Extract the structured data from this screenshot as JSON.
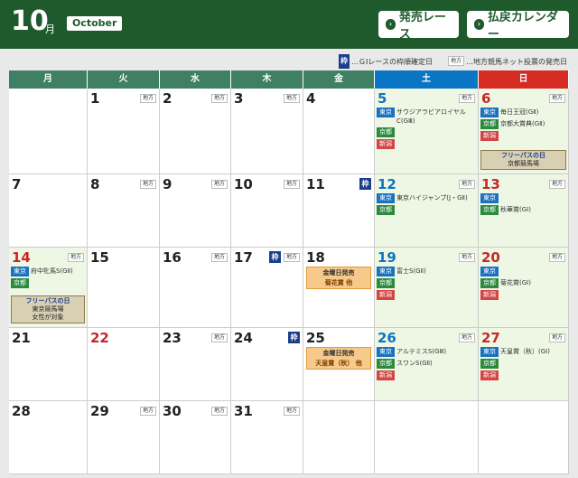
{
  "header": {
    "month": "10",
    "month_suffix": "月",
    "month_en": "October",
    "btn_race": "発売レース",
    "btn_payout": "払戻カレンダー",
    "btn_icon": "chevron-circle-icon"
  },
  "legend": {
    "waku_icon": "枠",
    "waku_text": "…ＧⅠレースの枠順確定日",
    "chiho_icon": "地方",
    "chiho_text": "…地方競馬ネット投票の発売日"
  },
  "weekdays": [
    "月",
    "火",
    "水",
    "木",
    "金",
    "土",
    "日"
  ],
  "weeks": [
    [
      {
        "day": "",
        "bg": "white"
      },
      {
        "day": "1",
        "chiho": "地方"
      },
      {
        "day": "2",
        "chiho": "地方"
      },
      {
        "day": "3",
        "chiho": "地方"
      },
      {
        "day": "4"
      },
      {
        "day": "5",
        "type": "sat",
        "bg": "green",
        "chiho": "地方",
        "events": [
          {
            "tag": "東京",
            "cls": "tokyo",
            "race": "サウジアラビアロイヤルC(GⅢ)"
          },
          {
            "tag": "京都",
            "cls": "kyoto",
            "race": ""
          },
          {
            "tag": "新潟",
            "cls": "niigata",
            "race": ""
          }
        ]
      },
      {
        "day": "6",
        "type": "sun",
        "bg": "green",
        "chiho": "地方",
        "events": [
          {
            "tag": "東京",
            "cls": "tokyo",
            "race": "毎日王冠(GⅡ)"
          },
          {
            "tag": "京都",
            "cls": "kyoto",
            "race": "京都大賞典(GⅡ)"
          },
          {
            "tag": "新潟",
            "cls": "niigata",
            "race": ""
          }
        ],
        "free": {
          "l1": "フリーパスの日",
          "l2": "京都競馬場",
          "l3": ""
        }
      }
    ],
    [
      {
        "day": "7"
      },
      {
        "day": "8",
        "chiho": "地方"
      },
      {
        "day": "9",
        "chiho": "地方"
      },
      {
        "day": "10",
        "chiho": "地方"
      },
      {
        "day": "11",
        "waku": "枠"
      },
      {
        "day": "12",
        "type": "sat",
        "bg": "green",
        "chiho": "地方",
        "events": [
          {
            "tag": "東京",
            "cls": "tokyo",
            "race": "東京ハイジャンプ(J・GⅡ)"
          },
          {
            "tag": "京都",
            "cls": "kyoto",
            "race": ""
          }
        ]
      },
      {
        "day": "13",
        "type": "sun",
        "bg": "green",
        "chiho": "地方",
        "events": [
          {
            "tag": "東京",
            "cls": "tokyo",
            "race": ""
          },
          {
            "tag": "京都",
            "cls": "kyoto",
            "race": "秋華賞(GⅠ)"
          }
        ]
      }
    ],
    [
      {
        "day": "14",
        "type": "sun",
        "bg": "green",
        "chiho": "地方",
        "events": [
          {
            "tag": "東京",
            "cls": "tokyo",
            "race": "府中牝馬S(GⅡ)"
          },
          {
            "tag": "京都",
            "cls": "kyoto",
            "race": ""
          }
        ],
        "free": {
          "l1": "フリーパスの日",
          "l2": "東京競馬場",
          "l3": "女性が対象"
        }
      },
      {
        "day": "15"
      },
      {
        "day": "16",
        "chiho": "地方"
      },
      {
        "day": "17",
        "chiho": "地方",
        "waku": "枠"
      },
      {
        "day": "18",
        "kin": {
          "l1": "金曜日発売",
          "l2": "菊花賞 他"
        }
      },
      {
        "day": "19",
        "type": "sat",
        "bg": "green",
        "chiho": "地方",
        "events": [
          {
            "tag": "東京",
            "cls": "tokyo",
            "race": "富士S(GⅡ)"
          },
          {
            "tag": "京都",
            "cls": "kyoto",
            "race": ""
          },
          {
            "tag": "新潟",
            "cls": "niigata",
            "race": ""
          }
        ]
      },
      {
        "day": "20",
        "type": "sun",
        "bg": "green",
        "chiho": "地方",
        "events": [
          {
            "tag": "東京",
            "cls": "tokyo",
            "race": ""
          },
          {
            "tag": "京都",
            "cls": "kyoto",
            "race": "菊花賞(GⅠ)"
          },
          {
            "tag": "新潟",
            "cls": "niigata",
            "race": ""
          }
        ]
      }
    ],
    [
      {
        "day": "21"
      },
      {
        "day": "22",
        "type": "sun"
      },
      {
        "day": "23",
        "chiho": "地方"
      },
      {
        "day": "24",
        "waku": "枠"
      },
      {
        "day": "25",
        "kin": {
          "l1": "金曜日発売",
          "l2": "天皇賞（秋） 他"
        }
      },
      {
        "day": "26",
        "type": "sat",
        "bg": "green",
        "chiho": "地方",
        "events": [
          {
            "tag": "東京",
            "cls": "tokyo",
            "race": "アルテミスS(GⅢ)"
          },
          {
            "tag": "京都",
            "cls": "kyoto",
            "race": "スワンS(GⅡ)"
          },
          {
            "tag": "新潟",
            "cls": "niigata",
            "race": ""
          }
        ]
      },
      {
        "day": "27",
        "type": "sun",
        "bg": "green",
        "chiho": "地方",
        "events": [
          {
            "tag": "東京",
            "cls": "tokyo",
            "race": "天皇賞（秋）(GⅠ)"
          },
          {
            "tag": "京都",
            "cls": "kyoto",
            "race": ""
          },
          {
            "tag": "新潟",
            "cls": "niigata",
            "race": ""
          }
        ]
      }
    ],
    [
      {
        "day": "28"
      },
      {
        "day": "29",
        "chiho": "地方"
      },
      {
        "day": "30",
        "chiho": "地方"
      },
      {
        "day": "31",
        "chiho": "地方"
      },
      {
        "day": ""
      },
      {
        "day": ""
      },
      {
        "day": ""
      }
    ]
  ]
}
